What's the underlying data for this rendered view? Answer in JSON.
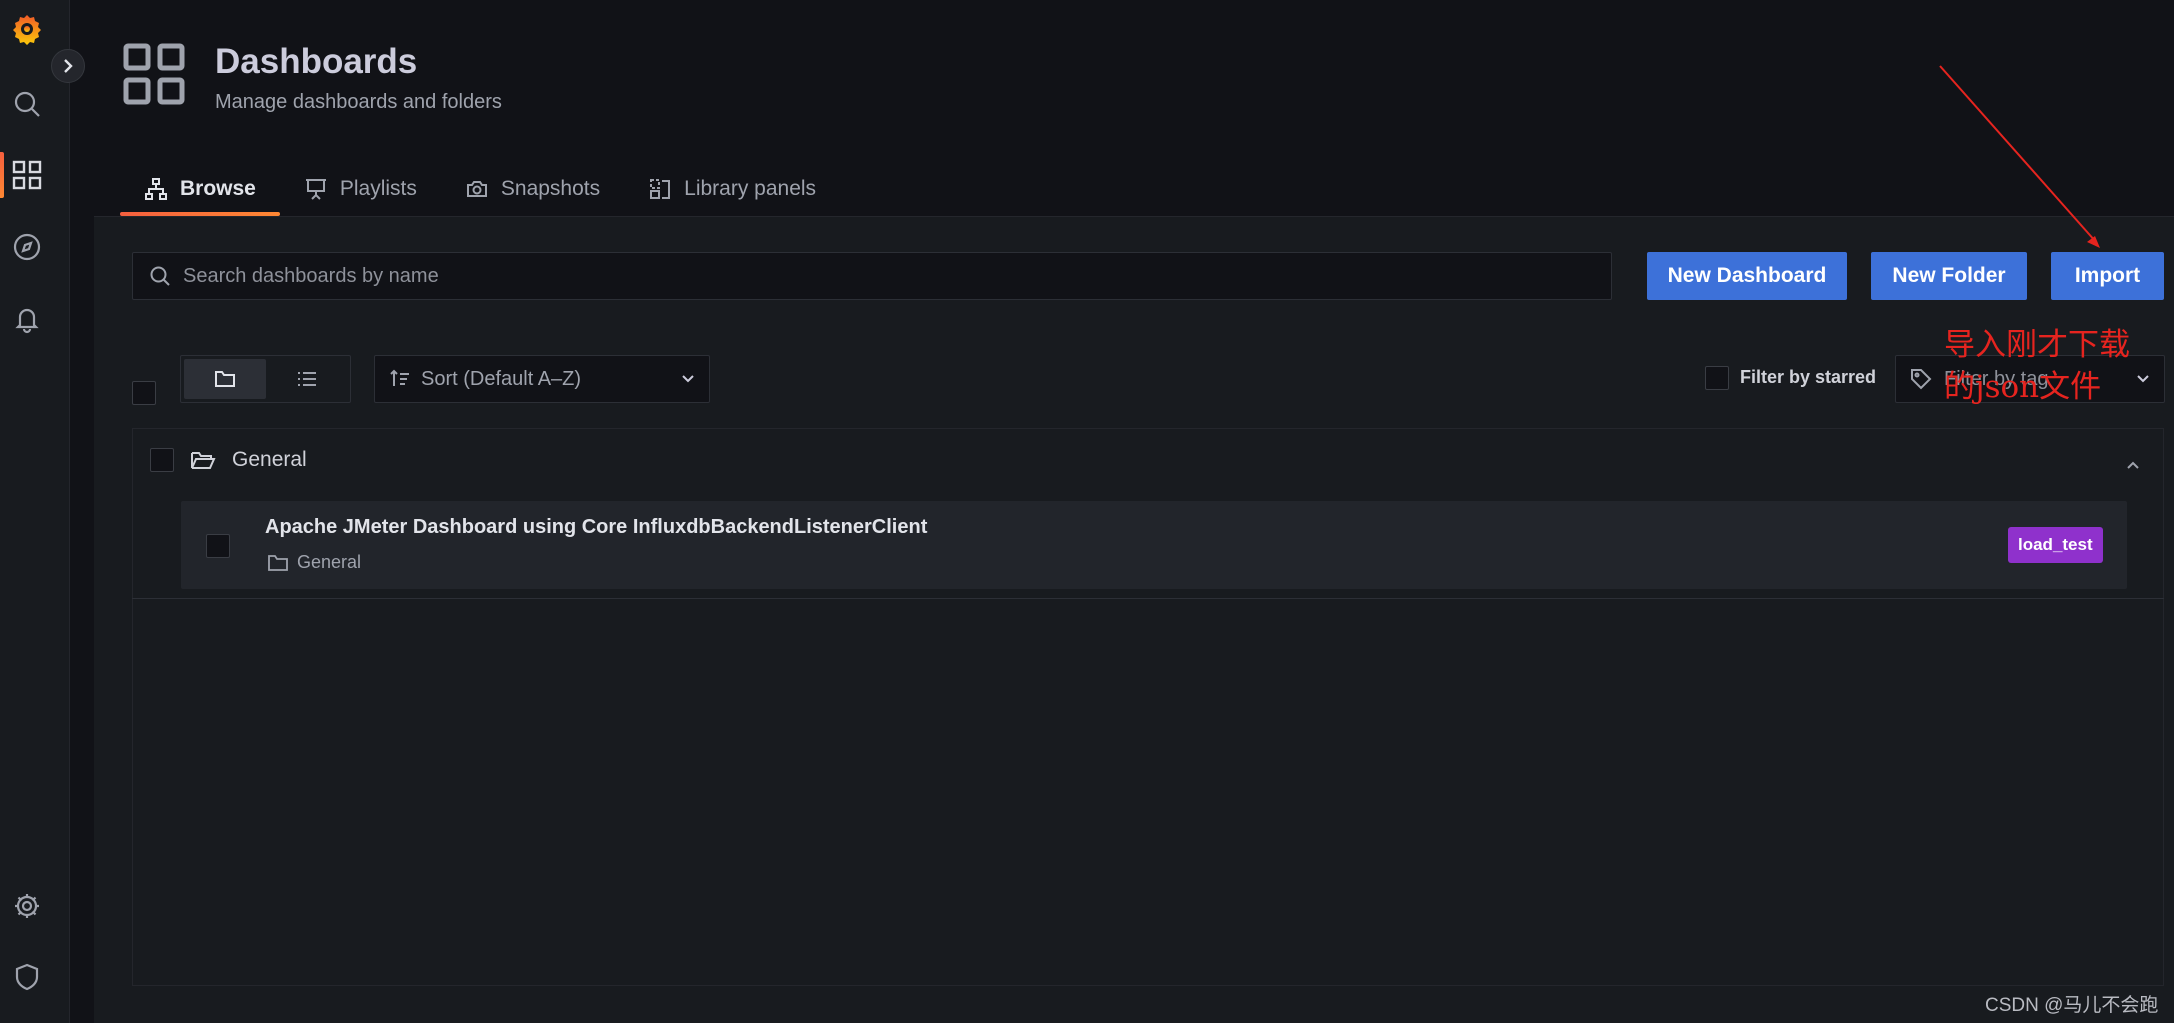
{
  "sidebar": {
    "items": [
      {
        "name": "search",
        "icon": "search-icon"
      },
      {
        "name": "dashboards",
        "icon": "dashboards-grid-icon",
        "active": true
      },
      {
        "name": "explore",
        "icon": "compass-icon"
      },
      {
        "name": "alerting",
        "icon": "bell-icon"
      },
      {
        "name": "configuration",
        "icon": "gear-icon"
      },
      {
        "name": "server-admin",
        "icon": "shield-icon"
      }
    ],
    "accent": "#f55f3e"
  },
  "header": {
    "title": "Dashboards",
    "subtitle": "Manage dashboards and folders"
  },
  "tabs": [
    {
      "label": "Browse",
      "icon": "sitemap-icon",
      "active": true
    },
    {
      "label": "Playlists",
      "icon": "presentation-icon"
    },
    {
      "label": "Snapshots",
      "icon": "camera-icon"
    },
    {
      "label": "Library panels",
      "icon": "library-panels-icon"
    }
  ],
  "toolbar": {
    "search_placeholder": "Search dashboards by name",
    "new_dashboard_label": "New Dashboard",
    "new_folder_label": "New Folder",
    "import_label": "Import",
    "sort_label": "Sort (Default A–Z)",
    "filter_starred_label": "Filter by starred",
    "filter_tag_placeholder": "Filter by tag",
    "button_color": "#3d71d9"
  },
  "folders": [
    {
      "name": "General",
      "dashboards": [
        {
          "title": "Apache JMeter Dashboard using Core InfluxdbBackendListenerClient",
          "folder": "General",
          "tags": [
            {
              "label": "load_test",
              "color": "#8f31cc"
            }
          ]
        }
      ]
    }
  ],
  "annotation": {
    "text": "导入刚才下载的json文件",
    "color": "#e6241f"
  },
  "watermark": "CSDN @马儿不会跑"
}
